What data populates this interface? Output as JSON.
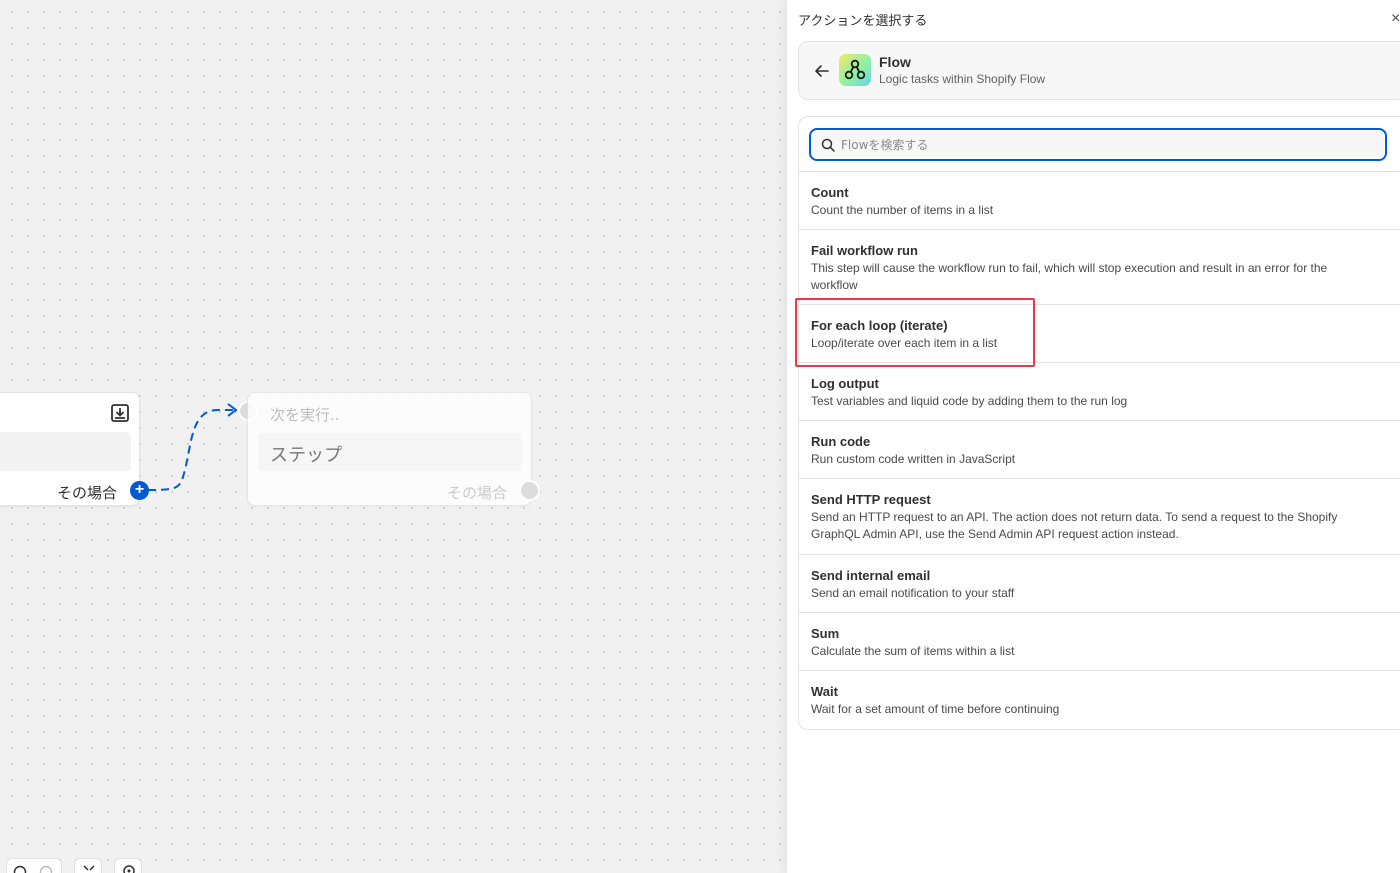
{
  "canvas": {
    "source_node": {
      "condition_label": "その場合"
    },
    "next_node": {
      "header": "次を実行..",
      "step_label": "ステップ",
      "condition_label": "その場合"
    }
  },
  "panel": {
    "title": "アクションを選択する",
    "close_symbol": "×",
    "app": {
      "name": "Flow",
      "description": "Logic tasks within Shopify Flow"
    },
    "search": {
      "placeholder": "Flowを検索する",
      "value": ""
    },
    "actions": [
      {
        "name": "Count",
        "description": "Count the number of items in a list"
      },
      {
        "name": "Fail workflow run",
        "description": "This step will cause the workflow run to fail, which will stop execution and result in an error for the workflow"
      },
      {
        "name": "For each loop (iterate)",
        "description": "Loop/iterate over each item in a list"
      },
      {
        "name": "Log output",
        "description": "Test variables and liquid code by adding them to the run log"
      },
      {
        "name": "Run code",
        "description": "Run custom code written in JavaScript"
      },
      {
        "name": "Send HTTP request",
        "description": "Send an HTTP request to an API. The action does not return data. To send a request to the Shopify GraphQL Admin API, use the Send Admin API request action instead."
      },
      {
        "name": "Send internal email",
        "description": "Send an email notification to your staff"
      },
      {
        "name": "Sum",
        "description": "Calculate the sum of items within a list"
      },
      {
        "name": "Wait",
        "description": "Wait for a set amount of time before continuing"
      }
    ]
  },
  "colors": {
    "accent": "#005bd3",
    "highlight": "#e8394c"
  }
}
